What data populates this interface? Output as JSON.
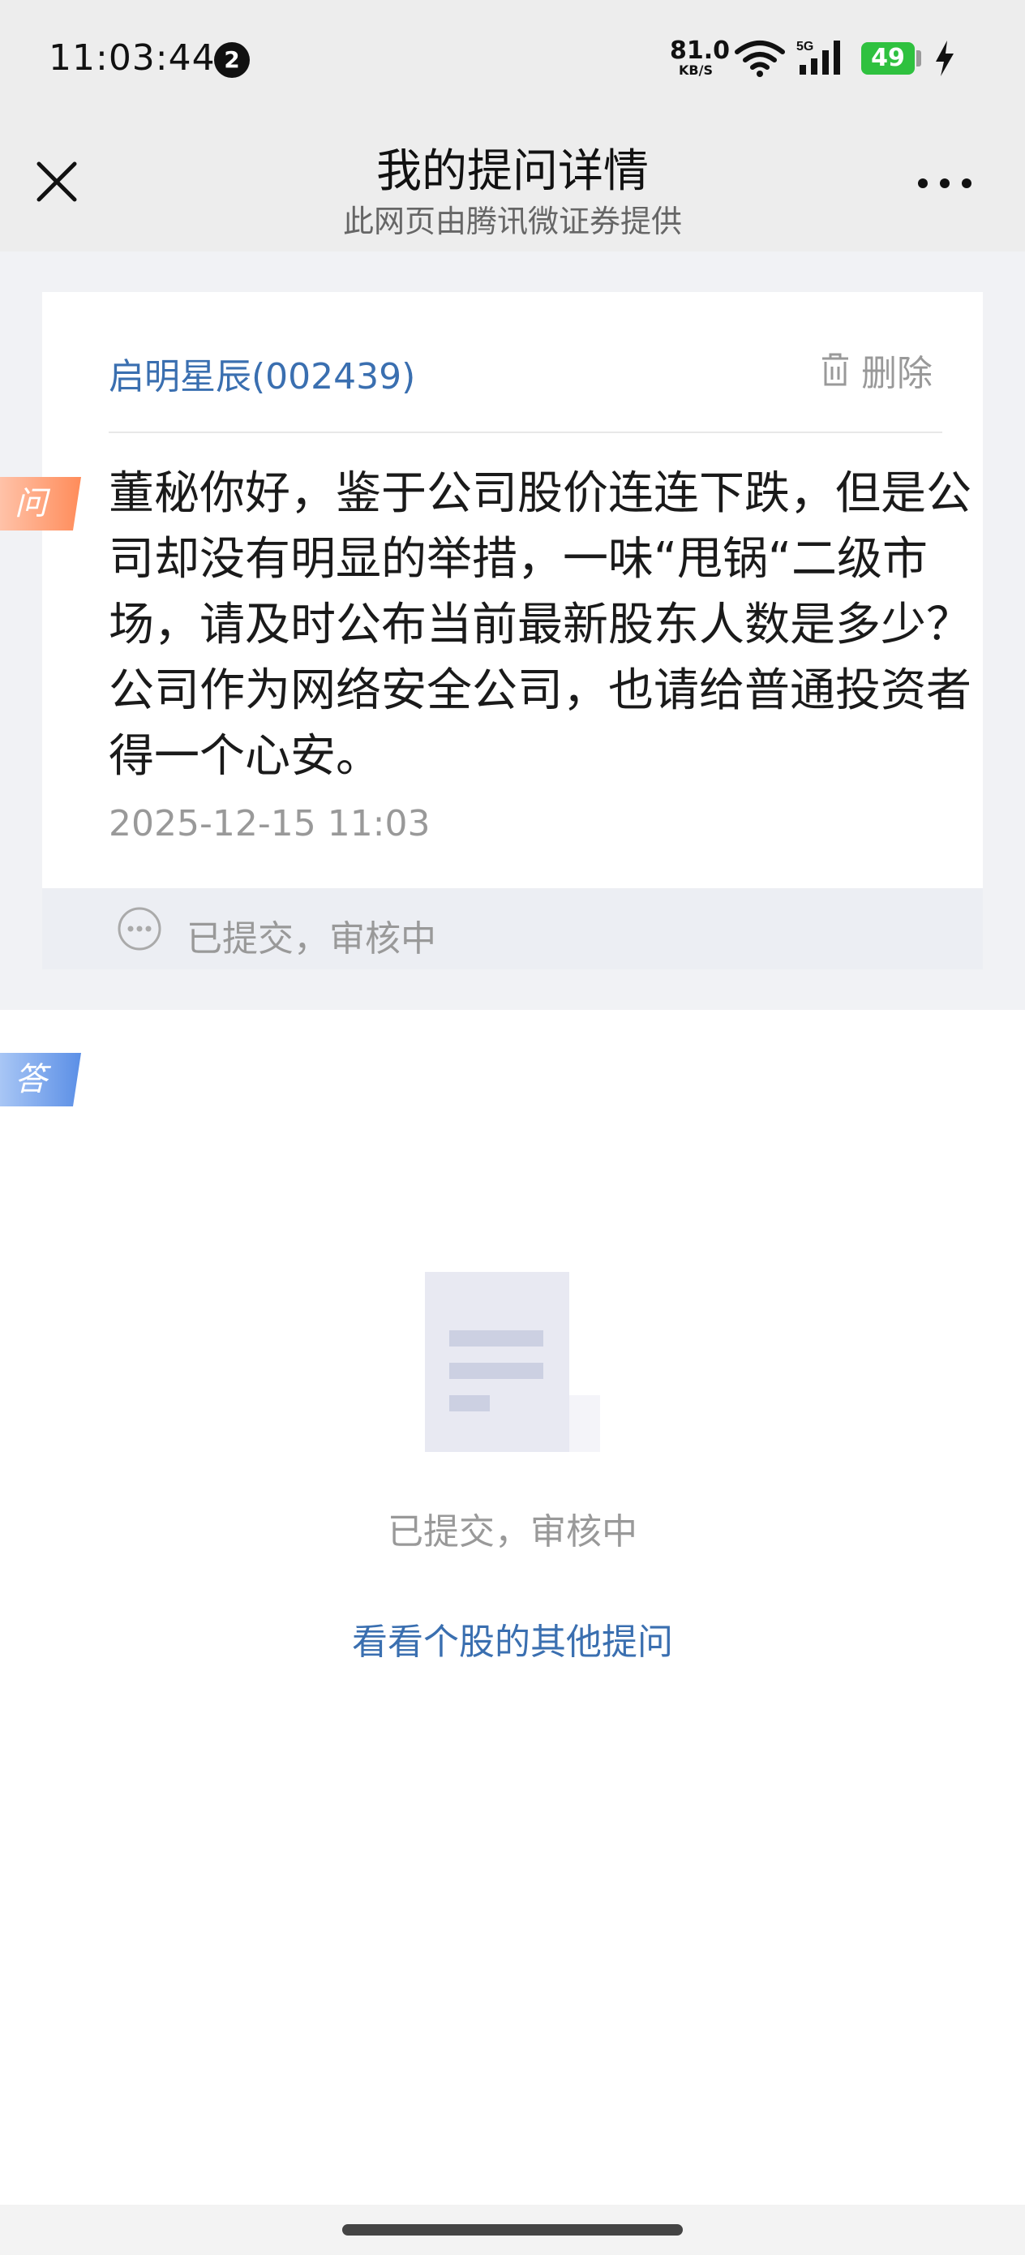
{
  "status": {
    "time": "11:03:44",
    "notification_count": "2",
    "net_speed": "81.0",
    "net_unit": "KB/S",
    "signal_type": "5G",
    "battery": "49",
    "icons": [
      "wifi-icon",
      "cellular-signal-icon",
      "battery-icon",
      "charging-icon"
    ]
  },
  "nav": {
    "title": "我的提问详情",
    "subtitle": "此网页由腾讯微证券提供",
    "icons": [
      "close-icon",
      "more-icon"
    ]
  },
  "question": {
    "stock": "启明星辰(002439)",
    "delete_label": "删除",
    "tag": "问",
    "text": "董秘你好，鉴于公司股价连连下跌，但是公司却没有明显的举措，一味“甩锅“二级市场，请及时公布当前最新股东人数是多少？公司作为网络安全公司，也请给普通投资者得一个心安。",
    "time": "2025-12-15 11:03",
    "status": "已提交，审核中"
  },
  "answer": {
    "tag": "答",
    "empty_text": "已提交，审核中",
    "link": "看看个股的其他提问"
  },
  "colors": {
    "link_blue": "#3a6fb0",
    "tag_question": "#ff8c5a",
    "tag_answer": "#5b8fe6",
    "battery_green": "#2fc13f"
  }
}
